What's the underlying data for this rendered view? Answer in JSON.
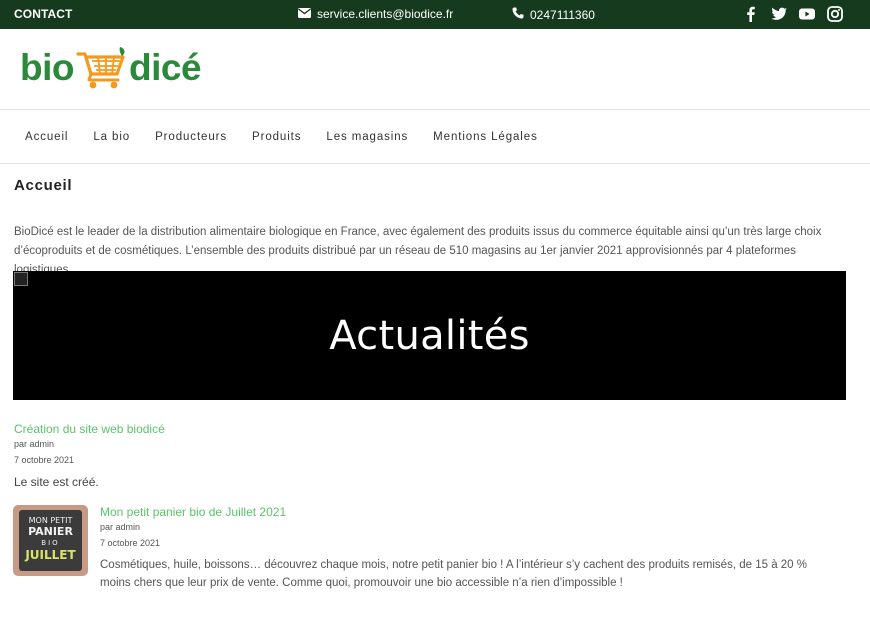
{
  "topbar": {
    "contact": "CONTACT",
    "email": "service.clients@biodice.fr",
    "phone": "0247111360",
    "social_icons": [
      "facebook-icon",
      "twitter-icon",
      "youtube-icon",
      "instagram-icon"
    ]
  },
  "logo": {
    "left": "bio",
    "right": "dicé",
    "icon": "shopping-cart-icon"
  },
  "nav": {
    "items": [
      "Accueil",
      "La bio",
      "Producteurs",
      "Produits",
      "Les magasins",
      "Mentions Légales"
    ]
  },
  "page": {
    "title": "Accueil",
    "intro": "BioDicé est le leader de la distribution alimentaire biologique en France, avec également des produits issus du commerce équitable ainsi qu’un très large choix d’écoproduits et de cosmétiques. L’ensemble des produits distribué par un réseau de 510 magasins au 1er janvier 2021 approvisionnés par 4 plateformes logistiques."
  },
  "banner": {
    "title": "Actualités"
  },
  "posts": [
    {
      "title": "Création du site web biodicé",
      "author": "par admin",
      "date": "7 octobre 2021",
      "excerpt": "Le site est créé."
    },
    {
      "title": "Mon petit panier bio de Juillet 2021",
      "author": "par admin",
      "date": "7 octobre 2021",
      "excerpt": "Cosmétiques, huile, boissons… découvrez chaque mois, notre petit panier bio ! A l’intérieur s’y cachent des produits remisés, de 15 à 20 % moins chers que leur prix de vente. Comme quoi, promouvoir une bio accessible n’a rien d’impossible !",
      "thumbnail_text": [
        "MON PETIT",
        "PANIER",
        "BIO",
        "JUILLET"
      ]
    }
  ],
  "colors": {
    "topbar": "#163a1d",
    "link_green": "#5cc36a",
    "logo_green": "#2a8a3a",
    "logo_orange": "#f29a1f"
  }
}
